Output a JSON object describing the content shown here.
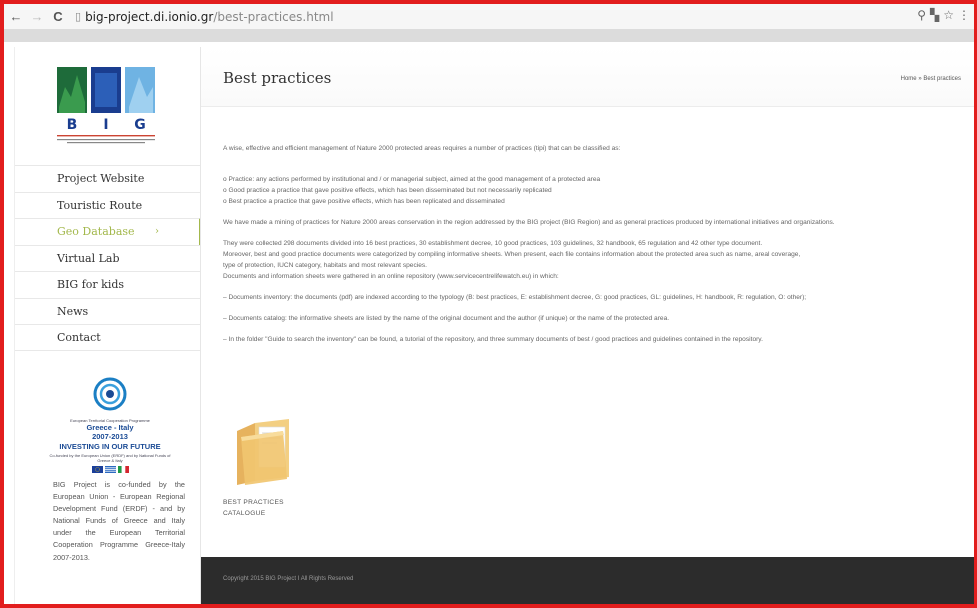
{
  "browser": {
    "back": "←",
    "forward": "→",
    "reload": "C",
    "url_host": "big-project.di.ionio.gr",
    "url_path": "/best-practices.html"
  },
  "sidebar": {
    "menu": [
      {
        "label": "Project Website"
      },
      {
        "label": "Touristic Route"
      },
      {
        "label": "Geo Database"
      },
      {
        "label": "Virtual Lab"
      },
      {
        "label": "BIG for kids"
      },
      {
        "label": "News"
      },
      {
        "label": "Contact"
      }
    ],
    "geo_chevron": "›",
    "eu_logo": {
      "line1": "European Territorial Cooperation Programme",
      "line2": "Greece - Italy",
      "line3": "2007-2013",
      "line4": "INVESTING IN OUR FUTURE",
      "line5": "Co-funded by the European Union (ERDF) and by National Funds of Greece & Italy"
    },
    "cofund_text": "BIG Project is co-funded by the European Union - European Regional Development Fund (ERDF) - and by National Funds of Greece and Italy under the European Territorial Cooperation Programme Greece-Italy 2007-2013."
  },
  "main": {
    "title": "Best practices",
    "breadcrumb": "Home » Best practices",
    "intro": "A wise, effective and efficient management of Nature 2000 protected areas requires a number of practices (tipi) that can be classified as:",
    "bullet1": "o Practice: any actions performed by institutional and / or managerial subject, aimed at the good management of a protected area",
    "bullet2": "o Good practice a practice that gave positive effects, which has been disseminated but not necessarily replicated",
    "bullet3": "o Best practice a practice that gave positive effects, which has been replicated and disseminated",
    "para2": "We have made a mining of practices for Nature 2000 areas conservation in the region addressed by the BIG project (BIG Region) and as general practices produced by international initiatives and organizations.",
    "para3a": "They were collected 298 documents divided into 16 best practices, 30 establishment decree, 10 good practices, 103 guidelines, 32 handbook, 65 regulation and 42 other type document.",
    "para3b": "Moreover, best and good practice documents were categorized by compiling informative sheets. When present, each file contains information about the protected area such as name, areal coverage,",
    "para3c": "type of protection, IUCN category, habitats and most relevant species.",
    "para3d": "Documents and information sheets were gathered in an online repository (www.servicecentrelifewatch.eu) in which:",
    "item1": "– Documents inventory: the documents (pdf) are indexed according to the typology (B: best practices, E: establishment decree, G: good practices, GL: guidelines, H: handbook, R: regulation, O: other);",
    "item2": "– Documents catalog: the informative sheets are listed by the name of the original document and the author (if unique) or the name of the protected area.",
    "item3": "– In the folder \"Guide to search the inventory\" can be found, a tutorial of the repository, and three summary documents of best / good practices and guidelines contained in the repository.",
    "catalog_line1": "BEST PRACTICES",
    "catalog_line2": "CATALOGUE"
  },
  "footer": {
    "text": "Copyright 2015 BIG Project I All Rights Reserved"
  },
  "colors": {
    "accent": "#a3b84c",
    "frame": "#e21d1d",
    "footer": "#2c2c2c"
  }
}
